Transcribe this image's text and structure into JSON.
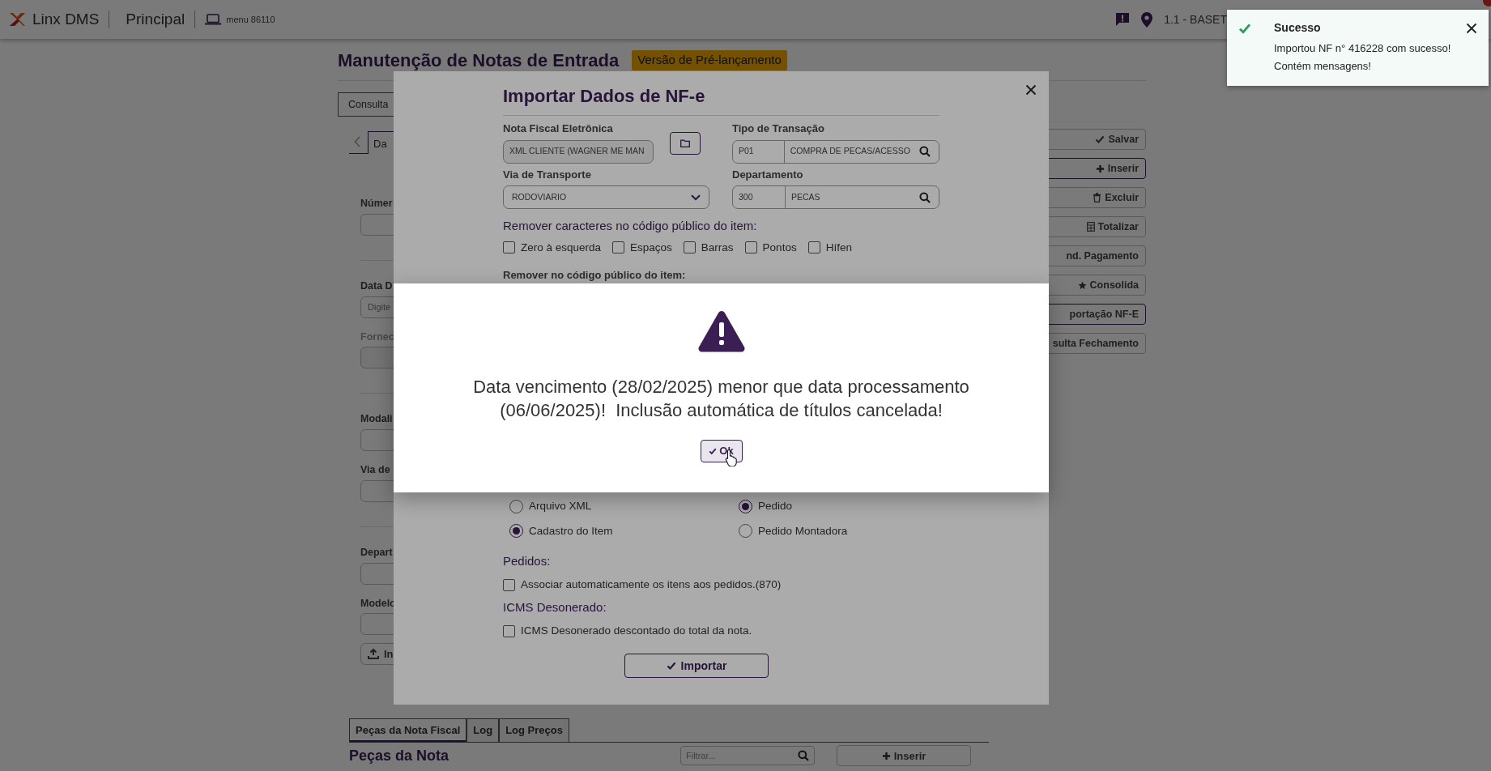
{
  "navbar": {
    "brand": "Linx DMS",
    "module": "Principal",
    "menu": "menu 86110",
    "location": "1.1 - BASET"
  },
  "page": {
    "title": "Manutenção de Notas de Entrada",
    "badge": "Versão de Pré-lançamento",
    "top_tab": "Consulta",
    "tab": "Da",
    "groups": [
      {
        "fields": [
          {
            "label": "Númer",
            "disabled": false
          }
        ]
      },
      {
        "fields": [
          {
            "label": "Data D",
            "placeholder": "Digite",
            "disabled": false
          },
          {
            "label": "Fornec",
            "disabled": true
          }
        ]
      },
      {
        "fields": [
          {
            "label": "Modali",
            "disabled": false
          },
          {
            "label": "Via de",
            "disabled": false
          }
        ]
      },
      {
        "fields": [
          {
            "label": "Depart",
            "disabled": false
          },
          {
            "label": "Modelo",
            "disabled": false
          }
        ]
      }
    ],
    "upload_button": "In",
    "actions": [
      {
        "label": "Salvar",
        "emphasis": false
      },
      {
        "label": "Inserir",
        "emphasis": true
      },
      {
        "label": "Excluir",
        "emphasis": false
      },
      {
        "label": "Totalizar",
        "emphasis": false
      },
      {
        "label": "nd. Pagamento",
        "emphasis": false
      },
      {
        "label": "Consolida",
        "emphasis": false
      },
      {
        "label": "portação NF-E",
        "emphasis": true
      },
      {
        "label": "sulta Fechamento",
        "emphasis": false
      }
    ],
    "bottom_tabs": [
      {
        "label": "Peças da Nota Fiscal",
        "selected": true
      },
      {
        "label": "Log",
        "selected": false
      },
      {
        "label": "Log Preços",
        "selected": false
      }
    ],
    "section_title": "Peças da Nota",
    "filter_placeholder": "Filtrar...",
    "insert_button": "Inserir"
  },
  "modal": {
    "title": "Importar Dados de NF-e",
    "nfe": {
      "label": "Nota Fiscal Eletrônica",
      "value": "XML CLIENTE (WAGNER ME MAN"
    },
    "transaction": {
      "label": "Tipo de Transação",
      "code": "P01",
      "name": "COMPRA DE PECAS/ACESSO"
    },
    "transport": {
      "label": "Via de Transporte",
      "value": "RODOVIARIO"
    },
    "department": {
      "label": "Departamento",
      "code": "300",
      "name": "PECAS"
    },
    "remove_chars": {
      "title": "Remover caracteres no código público do item:",
      "options": [
        {
          "label": "Zero à esquerda",
          "checked": false
        },
        {
          "label": "Espaços",
          "checked": false
        },
        {
          "label": "Barras",
          "checked": false
        },
        {
          "label": "Pontos",
          "checked": false
        },
        {
          "label": "Hífen",
          "checked": false
        }
      ]
    },
    "remove_label": "Remover no código público do item:",
    "radio_groups": [
      {
        "options": [
          {
            "label": "Arquivo XML",
            "selected": false
          },
          {
            "label": "Cadastro do Item",
            "selected": true
          }
        ]
      },
      {
        "options": [
          {
            "label": "Pedido",
            "selected": true
          },
          {
            "label": "Pedido Montadora",
            "selected": false
          }
        ]
      }
    ],
    "sections": [
      {
        "title": "Pedidos:",
        "option": {
          "label": "Associar automaticamente os itens aos pedidos.(870)",
          "checked": false
        }
      },
      {
        "title": "ICMS Desonerado:",
        "option": {
          "label": "ICMS Desonerado descontado do total da nota.",
          "checked": false
        }
      }
    ],
    "import_button": "Importar"
  },
  "alert": {
    "message": "Data vencimento (28/02/2025) menor que data processamento (06/06/2025)!  Inclusão automática de títulos cancelada!",
    "button": "Ok"
  },
  "toast": {
    "title": "Sucesso",
    "lines": [
      "Importou NF n° 416228 com sucesso!",
      "Contém mensagens!"
    ]
  }
}
